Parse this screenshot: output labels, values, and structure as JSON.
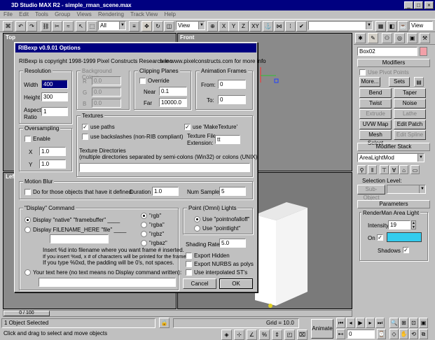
{
  "window": {
    "title": "3D Studio MAX R2 - simple_rman_scene.max"
  },
  "menu": [
    "File",
    "Edit",
    "Tools",
    "Group",
    "Views",
    "Rendering",
    "Track View",
    "Help"
  ],
  "toolbar": {
    "selection_filter": "All",
    "view_combo": "View",
    "named_sel": "",
    "view_combo2": "View",
    "axis_x": "X",
    "axis_y": "Y",
    "axis_z": "Z",
    "axis_xy": "XY"
  },
  "viewports": {
    "top": "Top",
    "front": "Front",
    "left": "Left"
  },
  "dialog": {
    "title": "RIBexp v0.9.01 Options",
    "copyright": "RIBexp is copyright 1998-1999 Pixel Constructs Research Inc.",
    "website": "see www.pixelconstructs.com  for more info",
    "resolution": {
      "label": "Resolution",
      "width_label": "Width",
      "width": "400",
      "height_label": "Height",
      "height": "300",
      "aspect_label": "Aspect Ratio",
      "aspect": "1"
    },
    "background": {
      "label": "Background Colour",
      "r_label": "R",
      "r": "0.0",
      "g_label": "G",
      "g": "0.0",
      "b_label": "B",
      "b": "0.0"
    },
    "clipping": {
      "label": "Clipping Planes",
      "override": "Override",
      "near_label": "Near",
      "near": "0.1",
      "far_label": "Far",
      "far": "10000.0"
    },
    "animation": {
      "label": "Animation Frames",
      "from_label": "From:",
      "from": "0",
      "to_label": "To:",
      "to": "0"
    },
    "textures": {
      "label": "Textures",
      "use_paths": "use paths",
      "use_maketexture": "use 'MakeTexture'",
      "use_backslashes": "use backslashes (non-RIB compliant)",
      "ext_label": "Texture File Extension:",
      "ext": "tt",
      "dirs_label": "Texture Directories",
      "dirs_hint": "(multiple directories separated by semi-colons (Win32) or colons (UNIX)",
      "dirs": ""
    },
    "oversampling": {
      "label": "Oversampling",
      "enable": "Enable",
      "x_label": "X",
      "x": "1.0",
      "y_label": "Y",
      "y": "1.0"
    },
    "motion_blur": {
      "label": "Motion Blur",
      "do_for": "Do for those objects that have it defined.",
      "duration_label": "Duration",
      "duration": "1.0",
      "samples_label": "Num Samples",
      "samples": "5"
    },
    "display": {
      "label": "\"Display\" Command",
      "native": "Display \"native\" \"framebuffer\" ____",
      "filename": "Display FILENAME_HERE \"file\" ____",
      "filename_value": "",
      "rgb": "\"rgb\"",
      "rgba": "\"rgba\"",
      "rgbz": "\"rgbz\"",
      "rgbaz": "\"rgbaz\"",
      "help1": "Insert %d into filename where you want frame # inserted.",
      "help2": "If you insert %xd, x # of characters will be printed for the frame #.",
      "help3": "If you type %0xd, the padding will be 0's, not spaces.",
      "custom": "Your text here (no text means no Display command written):",
      "custom_value": ""
    },
    "point_lights": {
      "label": "Point (Omni) Lights",
      "falloff": "Use \"pointnofalloff\"",
      "pointlight": "Use \"pointlight\""
    },
    "shading_rate_label": "Shading Rate:",
    "shading_rate": "5.0",
    "export_hidden": "Export Hidden",
    "export_nurbs": "Export NURBS as polys",
    "use_st": "Use interpolated ST's",
    "cancel": "Cancel",
    "ok": "OK"
  },
  "panel": {
    "object_name": "Box02",
    "modifiers_title": "Modifiers",
    "use_pivot": "Use Pivot Points",
    "more": "More...",
    "sets": "Sets",
    "buttons": [
      "Bend",
      "Taper",
      "Twist",
      "Noise",
      "Extrude",
      "Lathe",
      "UVW Map",
      "Edit Patch",
      "Mesh Select",
      "Edit Spline"
    ],
    "stack_title": "Modifier Stack",
    "stack_value": "AreaLightMod",
    "selection_level": "Selection Level:",
    "sub_object": "Sub-Object",
    "params_title": "Parameters",
    "area_light": "RenderMan Area Light",
    "intensity_label": "Intensity",
    "intensity": "19",
    "on_label": "On",
    "shadows_label": "Shadows",
    "light_color": "#33ccee"
  },
  "timeline": {
    "frame": "0 / 100"
  },
  "status": {
    "selection": "1 Object Selected",
    "prompt": "Click and drag to select and move objects",
    "grid": "Grid = 10.0",
    "animate": "Animate",
    "frame": "0"
  }
}
